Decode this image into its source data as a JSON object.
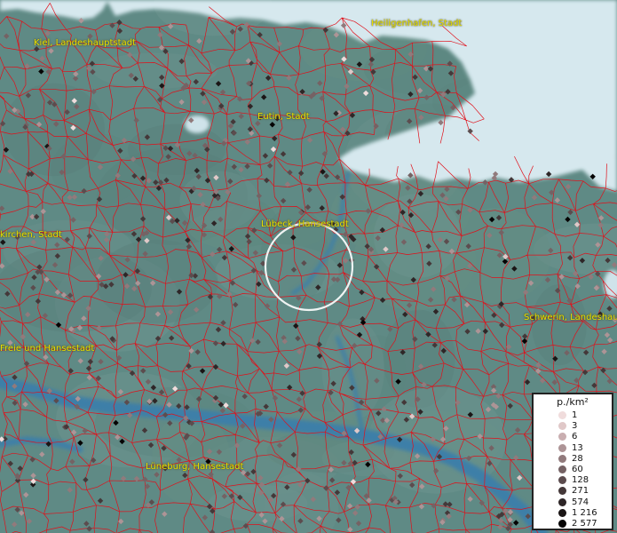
{
  "map": {
    "colors": {
      "land": "#5f8a85",
      "sea": "#d6e8ee",
      "water": "#3d7fa8",
      "border": "#e0101a",
      "label": "#e8e000"
    },
    "labels": [
      {
        "name": "place-heiligenhafen",
        "text": "Heiligenhafen, Stadt"
      },
      {
        "name": "place-kiel",
        "text": "Kiel, Landeshauptstadt"
      },
      {
        "name": "place-eutin",
        "text": "Eutin, Stadt"
      },
      {
        "name": "place-luebeck",
        "text": "Lübeck, Hansestadt"
      },
      {
        "name": "place-neumuenster",
        "text": "kirchen, Stadt"
      },
      {
        "name": "place-schwerin",
        "text": "Schwerin, Landeshau"
      },
      {
        "name": "place-hamburg",
        "text": "Freie und Hansestadt"
      },
      {
        "name": "place-lueneburg",
        "text": "Lüneburg, Hansestadt"
      }
    ],
    "focus_marker": "selection-circle"
  },
  "legend": {
    "title": "p./km²",
    "items": [
      {
        "label": "1",
        "color": "#f0dcdc"
      },
      {
        "label": "3",
        "color": "#e0c8c8"
      },
      {
        "label": "6",
        "color": "#c9aeb0"
      },
      {
        "label": "13",
        "color": "#ad9496"
      },
      {
        "label": "28",
        "color": "#917a7c"
      },
      {
        "label": "60",
        "color": "#756264"
      },
      {
        "label": "128",
        "color": "#5c4c4e"
      },
      {
        "label": "271",
        "color": "#443839"
      },
      {
        "label": "574",
        "color": "#2e2627"
      },
      {
        "label": "1 216",
        "color": "#1a1515"
      },
      {
        "label": "2 577",
        "color": "#050303"
      }
    ]
  }
}
